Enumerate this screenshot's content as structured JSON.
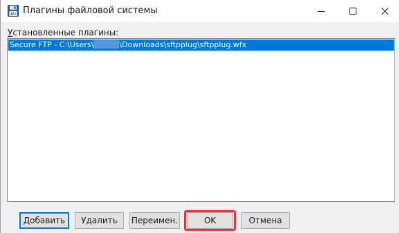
{
  "window": {
    "title": "Плагины файловой системы",
    "icon": "floppy-disk-icon"
  },
  "titlebar_buttons": {
    "minimize_icon": "minimize-icon",
    "maximize_icon": "maximize-icon",
    "close_icon": "close-icon"
  },
  "plugins_list": {
    "label_accel": "У",
    "label_rest": "становленные плагины:",
    "items": [
      {
        "text_before": "Secure FTP  - C:\\Users\\",
        "text_after": "\\Downloads\\sftpplug\\sftpplug.wfx",
        "selected": true
      }
    ]
  },
  "buttons": {
    "add": "Добавить",
    "remove": "Удалить",
    "rename": "Переимен.",
    "ok": "OK",
    "cancel": "Отмена"
  },
  "colors": {
    "selection": "#0078d7",
    "highlight": "#e0373f"
  }
}
